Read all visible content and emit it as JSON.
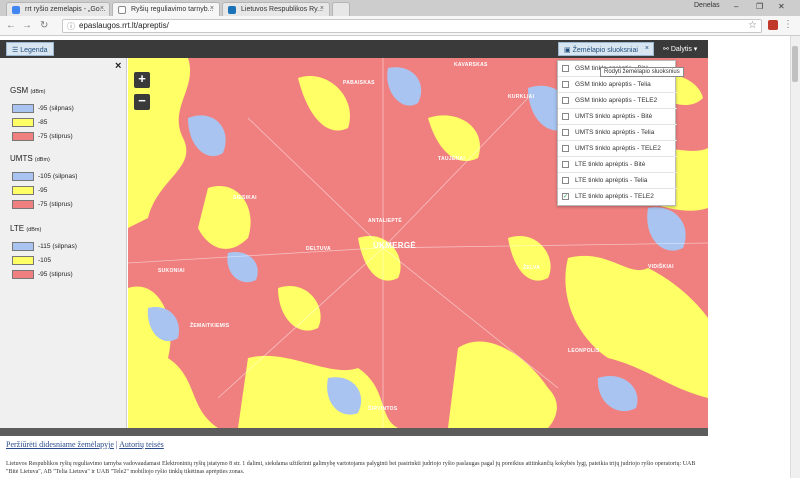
{
  "browser": {
    "tabs": [
      {
        "title": "rrt ryšio zemelapis - „Go..."
      },
      {
        "title": "Ryšių reguliavimo tarnyb..."
      },
      {
        "title": "Lietuvos Respublikos Ry..."
      }
    ],
    "user": "Denelas",
    "url": "epaslaugos.rrt.lt/apreptis/",
    "colors": {
      "tab_google": "#4285f4",
      "tab_rrt": "#1a73b8",
      "tab_lt": "#1a73b8"
    }
  },
  "topbar": {
    "legend_label": "Legenda",
    "layers_label": "Žemėlapio sluoksniai",
    "share_label": "Dalytis"
  },
  "legend": {
    "close": "×",
    "gsm": {
      "title": "GSM",
      "unit": "(dBm)",
      "items": [
        "-95 (silpnas)",
        "-85",
        "-75 (stiprus)"
      ]
    },
    "umts": {
      "title": "UMTS",
      "unit": "(dBm)",
      "items": [
        "-105 (silpnas)",
        "-95",
        "-75 (stiprus)"
      ]
    },
    "lte": {
      "title": "LTE",
      "unit": "(dBm)",
      "items": [
        "-115 (silpnas)",
        "-105",
        "-95 (stiprus)"
      ]
    },
    "colors": {
      "weak": "#a9c4f0",
      "medium": "#ffff66",
      "strong": "#f08080"
    }
  },
  "map": {
    "zoom_in": "+",
    "zoom_out": "−",
    "labels": [
      "UKMERGĖ",
      "ŽELVA",
      "DELTUVA",
      "SIESIKAI",
      "KAVARSKAS",
      "TAUJĖNAI",
      "VIDIŠKIAI",
      "PABAISKAS",
      "ŠIRVINTOS",
      "ANTALIEPTĖ",
      "ŽEMAITKIEMIS",
      "SUKONIAI",
      "LEONPOLIS",
      "KURKLIAI"
    ]
  },
  "layers": {
    "tooltip": "Rodyti žemėlapio sluoksnius",
    "items": [
      {
        "label": "GSM tinklo aprėptis - Bitė",
        "checked": false
      },
      {
        "label": "GSM tinklo aprėptis - Telia",
        "checked": false
      },
      {
        "label": "GSM tinklo aprėptis - TELE2",
        "checked": false
      },
      {
        "label": "UMTS tinklo aprėptis - Bitė",
        "checked": false
      },
      {
        "label": "UMTS tinklo aprėptis - Telia",
        "checked": false
      },
      {
        "label": "UMTS tinklo aprėptis - TELE2",
        "checked": false
      },
      {
        "label": "LTE tinklo aprėptis - Bitė",
        "checked": false
      },
      {
        "label": "LTE tinklo aprėptis - Telia",
        "checked": false
      },
      {
        "label": "LTE tinklo aprėptis - TELE2",
        "checked": true
      }
    ]
  },
  "footer": {
    "link_larger": "Peržiūrėti didesniame žemėlapyje",
    "separator": "|",
    "link_copyright": "Autorių teisės",
    "text": "Lietuvos Respublikos ryšių reguliavimo tarnyba vadovaudamasi Elektroninių ryšių įstatymo 8 str. 1 dalimi, siekdama užtikrinti galimybę vartotojams palyginti bei pasirinkti judriojo ryšio paslaugas pagal jų poreikius atitinkančią kokybės lygį, pateikia trijų judriojo ryšio operatorių: UAB \"Bitė Lietuva\", AB \"Telia Lietuva\" ir UAB \"Tele2\" mobiliojo ryšio tinklų tikėtinas aprėpties zonas."
  }
}
